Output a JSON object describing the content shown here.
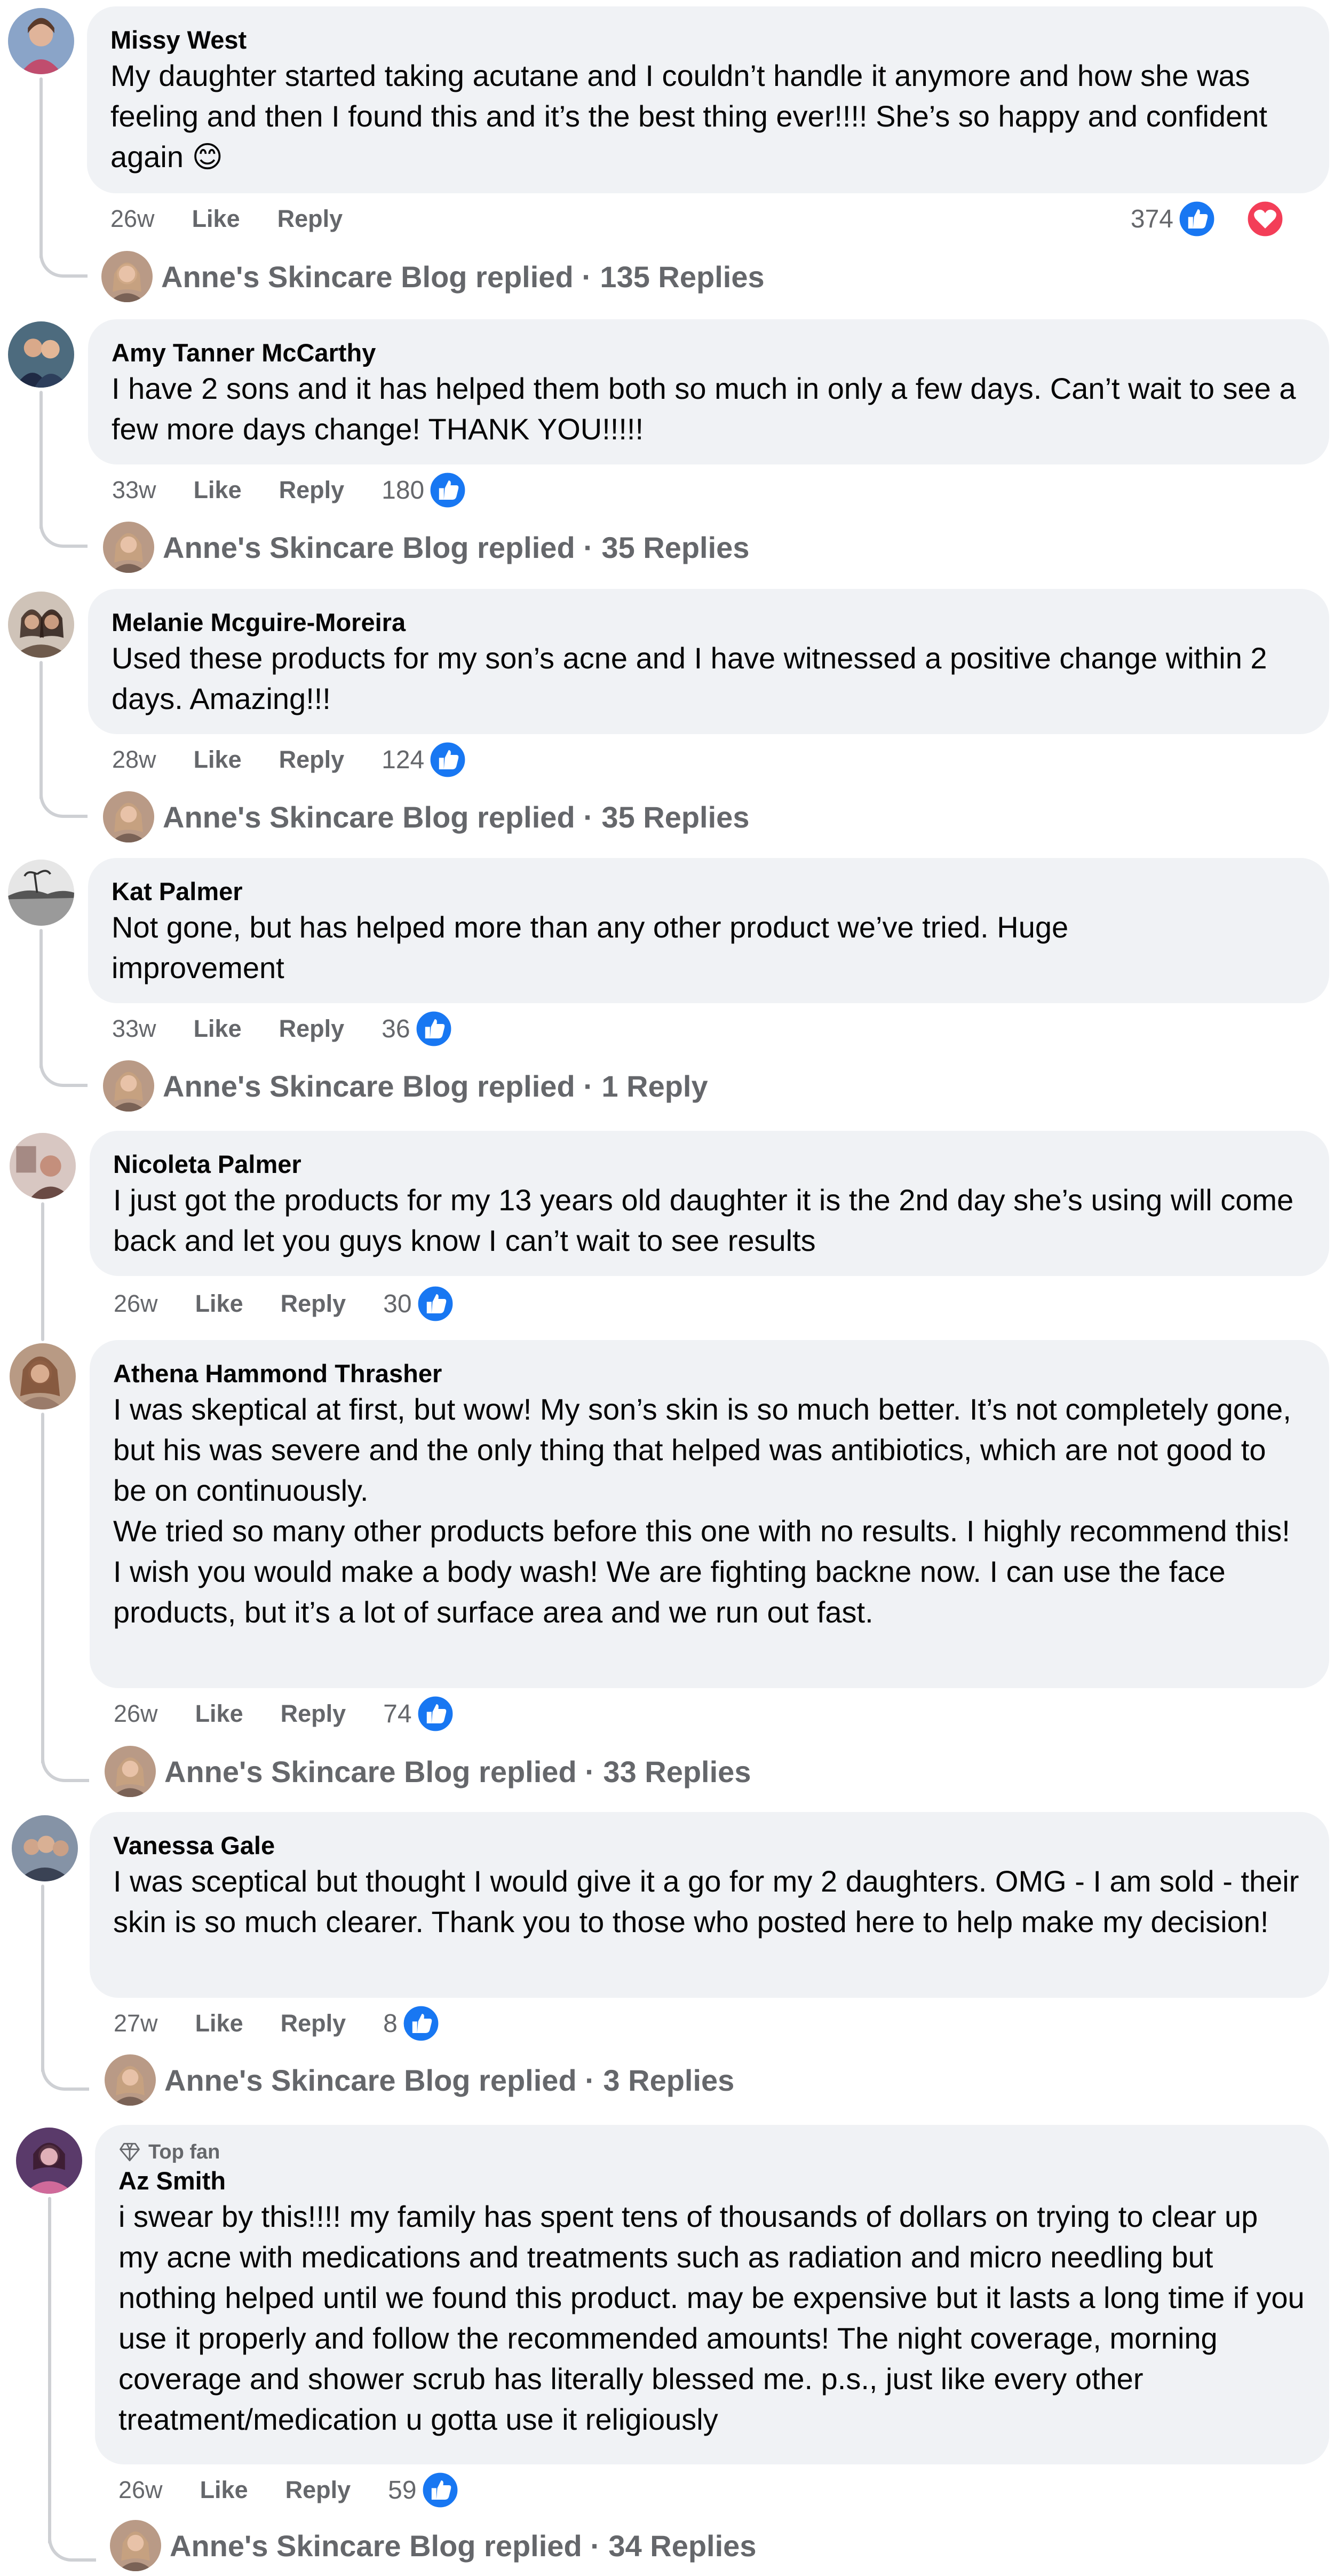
{
  "colors": {
    "bubble": "#f0f2f5",
    "meta": "#65676b",
    "like_blue": "#1877f2",
    "love_red": "#f33e58"
  },
  "labels": {
    "like": "Like",
    "reply": "Reply"
  },
  "comments": [
    {
      "author": "Missy West",
      "text": "My daughter started taking acutane and I couldn’t handle it anymore and how she was feeling and then I found this and it’s the best thing ever!!!! She’s so happy and confident again 😊",
      "time": "26w",
      "reactions": "374",
      "reaction_icons": [
        "like-icon",
        "love-icon"
      ],
      "reply_summary": "Anne's Skincare Blog replied · 135 Replies"
    },
    {
      "author": "Amy Tanner McCarthy",
      "text": "I have 2 sons and it has helped them both so much in only a few days. Can’t wait to see a few more days change! THANK YOU!!!!!",
      "time": "33w",
      "reactions": "180",
      "reaction_icons": [
        "like-icon"
      ],
      "reply_summary": "Anne's Skincare Blog replied · 35 Replies"
    },
    {
      "author": "Melanie Mcguire-Moreira",
      "text": "Used these products for my son’s acne and I have witnessed a positive change within 2 days. Amazing!!!",
      "time": "28w",
      "reactions": "124",
      "reaction_icons": [
        "like-icon"
      ],
      "reply_summary": "Anne's Skincare Blog replied · 35 Replies"
    },
    {
      "author": "Kat Palmer",
      "text": "Not gone, but has helped more than any other product we’ve tried. Huge improvement",
      "time": "33w",
      "reactions": "36",
      "reaction_icons": [
        "like-icon"
      ],
      "reply_summary": "Anne's Skincare Blog replied · 1 Reply"
    },
    {
      "author": "Nicoleta Palmer",
      "text": "I just got the products for my 13 years old daughter it is the 2nd day she’s using will come back and let you guys know I can’t wait to see results",
      "time": "26w",
      "reactions": "30",
      "reaction_icons": [
        "like-icon"
      ],
      "reply_summary": ""
    },
    {
      "author": "Athena Hammond Thrasher",
      "text": "I was skeptical at first, but wow! My son’s skin is so much better. It’s not completely gone, but his was severe and the only thing that helped was antibiotics, which are not good to be on continuously.\nWe tried so many other products before this one with no results. I highly recommend this!\nI wish you would make a body wash! We are fighting backne now. I can use the face products, but it’s a lot of surface area and we run out fast.",
      "time": "26w",
      "reactions": "74",
      "reaction_icons": [
        "like-icon"
      ],
      "reply_summary": "Anne's Skincare Blog replied · 33 Replies"
    },
    {
      "author": "Vanessa Gale",
      "text": "I was sceptical but thought I would give it a go for my 2 daughters. OMG - I am sold - their skin is so much clearer. Thank you to those who posted here to help make my decision!",
      "time": "27w",
      "reactions": "8",
      "reaction_icons": [
        "like-icon"
      ],
      "reply_summary": "Anne's Skincare Blog replied · 3 Replies"
    },
    {
      "author": "Az Smith",
      "badge": "Top fan",
      "text": "i swear by this!!!! my family has spent tens of thousands of dollars on trying to clear up my acne with medications and treatments such as radiation and micro needling but nothing helped until we found this product. may be expensive but it lasts a long time if you use it properly and follow the recommended amounts! The night coverage, morning coverage and shower scrub has literally blessed me. p.s., just like every other treatment/medication u gotta use it religiously",
      "time": "26w",
      "reactions": "59",
      "reaction_icons": [
        "like-icon"
      ],
      "reply_summary": "Anne's Skincare Blog replied · 34 Replies"
    }
  ]
}
